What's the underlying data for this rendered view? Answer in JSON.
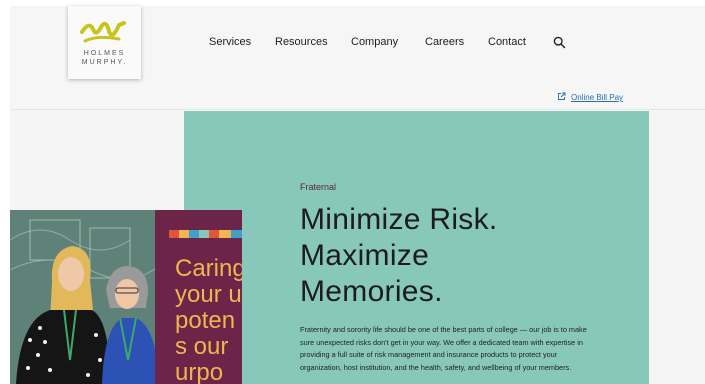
{
  "logo": {
    "line1": "HOLMES",
    "line2": "MURPHY."
  },
  "nav": {
    "items": [
      "Services",
      "Resources",
      "Company",
      "Careers",
      "Contact"
    ]
  },
  "utility": {
    "bill_pay": "Online Bill Pay"
  },
  "hero": {
    "eyebrow": "Fraternal",
    "headline": [
      "Minimize Risk.",
      "Maximize",
      "Memories."
    ],
    "body": "Fraternity and sorority life should be one of the best parts of college — our job is to make sure unexpected risks don't get in your way. We offer a dedicated team with expertise in providing a full suite of risk management and insurance products to protect your organization, host institution, and the health, safety, and wellbeing of your members."
  },
  "photo": {
    "banner_lines": [
      "Caring",
      "your u",
      "poten",
      "s our",
      "urpo"
    ]
  },
  "colors": {
    "hero_bg": "#87c8bb",
    "eyebrow": "#5a1f3a",
    "link": "#2a6fb0",
    "logo_mark": "#c9c41d",
    "banner": "#6c2449",
    "banner_text": "#f0b450"
  },
  "icons": [
    "search-icon",
    "external-link-icon",
    "holmes-murphy-logo-mark"
  ]
}
